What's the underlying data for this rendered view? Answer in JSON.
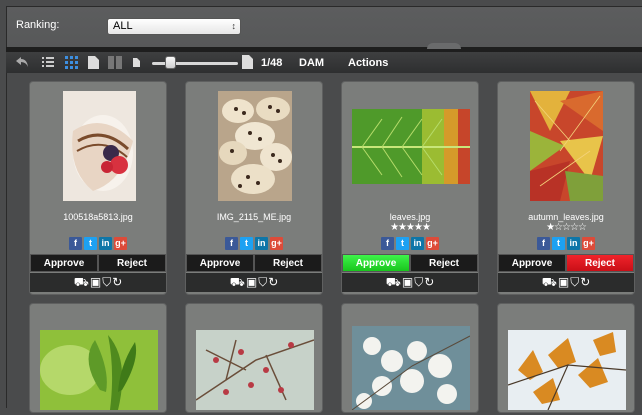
{
  "filter": {
    "label": "Ranking:",
    "selected": "ALL",
    "arrows": "↕"
  },
  "toolbar": {
    "page_indicator": "1/48",
    "dam_label": "DAM",
    "actions_label": "Actions"
  },
  "cards": [
    {
      "filename": "100518a5813.jpg",
      "stars": "",
      "approve_label": "Approve",
      "reject_label": "Reject",
      "approved": false,
      "rejected": false
    },
    {
      "filename": "IMG_2115_ME.jpg",
      "stars": "",
      "approve_label": "Approve",
      "reject_label": "Reject",
      "approved": false,
      "rejected": false
    },
    {
      "filename": "leaves.jpg",
      "stars": "★★★★★",
      "approve_label": "Approve",
      "reject_label": "Reject",
      "approved": true,
      "rejected": false
    },
    {
      "filename": "autumn_leaves.jpg",
      "stars": "★☆☆☆☆",
      "approve_label": "Approve",
      "reject_label": "Reject",
      "approved": false,
      "rejected": true
    }
  ],
  "social": {
    "facebook": "f",
    "twitter": "t",
    "linkedin": "in",
    "googleplus": "g+"
  },
  "colors": {
    "approve_active": "#22d42a",
    "reject_active": "#e0141c",
    "facebook": "#3b5998",
    "twitter": "#1da1f2",
    "linkedin": "#0e76a8",
    "googleplus": "#dd4b39"
  }
}
